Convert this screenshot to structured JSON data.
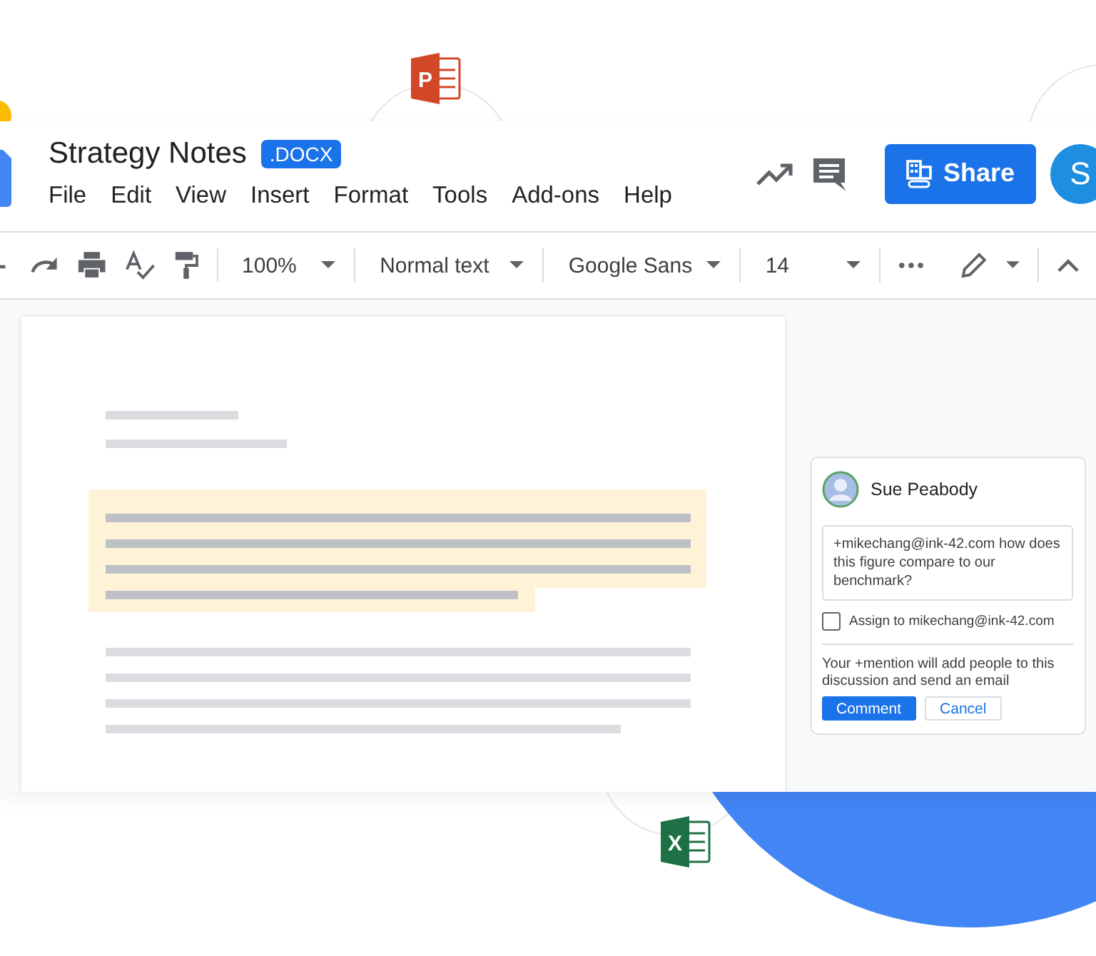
{
  "document": {
    "title": "Strategy Notes",
    "badge": ".DOCX"
  },
  "menu": [
    "File",
    "Edit",
    "View",
    "Insert",
    "Format",
    "Tools",
    "Add-ons",
    "Help"
  ],
  "share_button": {
    "label": "Share"
  },
  "avatar": {
    "letter": "S"
  },
  "toolbar": {
    "zoom": "100%",
    "style": "Normal text",
    "font": "Google Sans",
    "size": "14"
  },
  "comment": {
    "author": "Sue Peabody",
    "text": "+mikechang@ink-42.com how does this figure compare to our benchmark?",
    "assign": {
      "label": "Assign to mikechang@ink-42.com",
      "checked": false
    },
    "note": "Your +mention will add people to this discussion and send an email",
    "buttons": [
      {
        "label": "Comment",
        "kind": "primary"
      },
      {
        "label": "Cancel",
        "kind": "secondary"
      }
    ]
  },
  "floating_icons": [
    {
      "letter": "P",
      "color": "#d24726"
    },
    {
      "letter": "X",
      "color": "#1e7145"
    }
  ]
}
